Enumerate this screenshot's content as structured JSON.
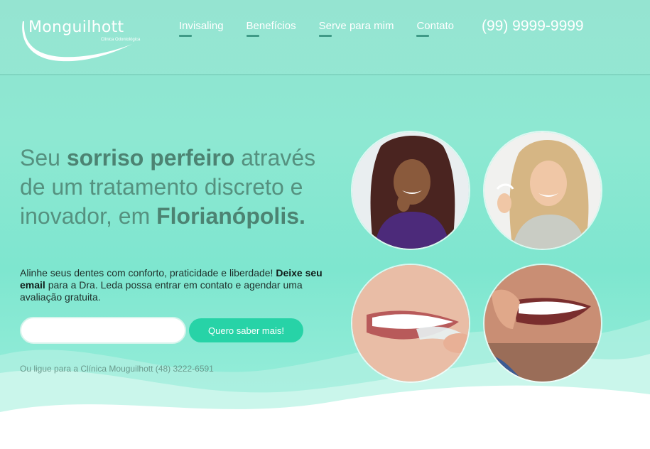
{
  "header": {
    "logo": {
      "name": "Monguilhott",
      "subtitle": "Clínica Odontológica"
    },
    "nav": [
      {
        "label": "Invisaling"
      },
      {
        "label": "Benefícios"
      },
      {
        "label": "Serve para mim"
      },
      {
        "label": "Contato"
      }
    ],
    "phone": "(99) 9999-9999"
  },
  "hero": {
    "title_part1": "Seu ",
    "title_bold1": "sorriso perfeiro",
    "title_part2": " através de um tratamento discreto e inovador, em ",
    "title_bold2": "Florianópolis.",
    "desc_part1": "Alinhe seus dentes com conforto, praticidade e liberdade! ",
    "desc_bold": "Deixe seu email",
    "desc_part2": " para a Dra. Leda possa entrar em contato e agendar uma avaliação gratuita.",
    "email_value": "",
    "email_placeholder": "",
    "cta_label": "Quero saber mais!",
    "call_text": "Ou ligue para a Clínica Mouguilhott (48) 3222-6591"
  },
  "photos": [
    {
      "icon": "woman-curly-hair-holding-aligner-photo"
    },
    {
      "icon": "woman-blonde-holding-aligner-photo"
    },
    {
      "icon": "smile-closeup-aligner-photo"
    },
    {
      "icon": "man-inserting-aligner-photo"
    }
  ],
  "colors": {
    "accent": "#27d3a7",
    "title": "#55917f",
    "underline": "#3f9a87"
  }
}
